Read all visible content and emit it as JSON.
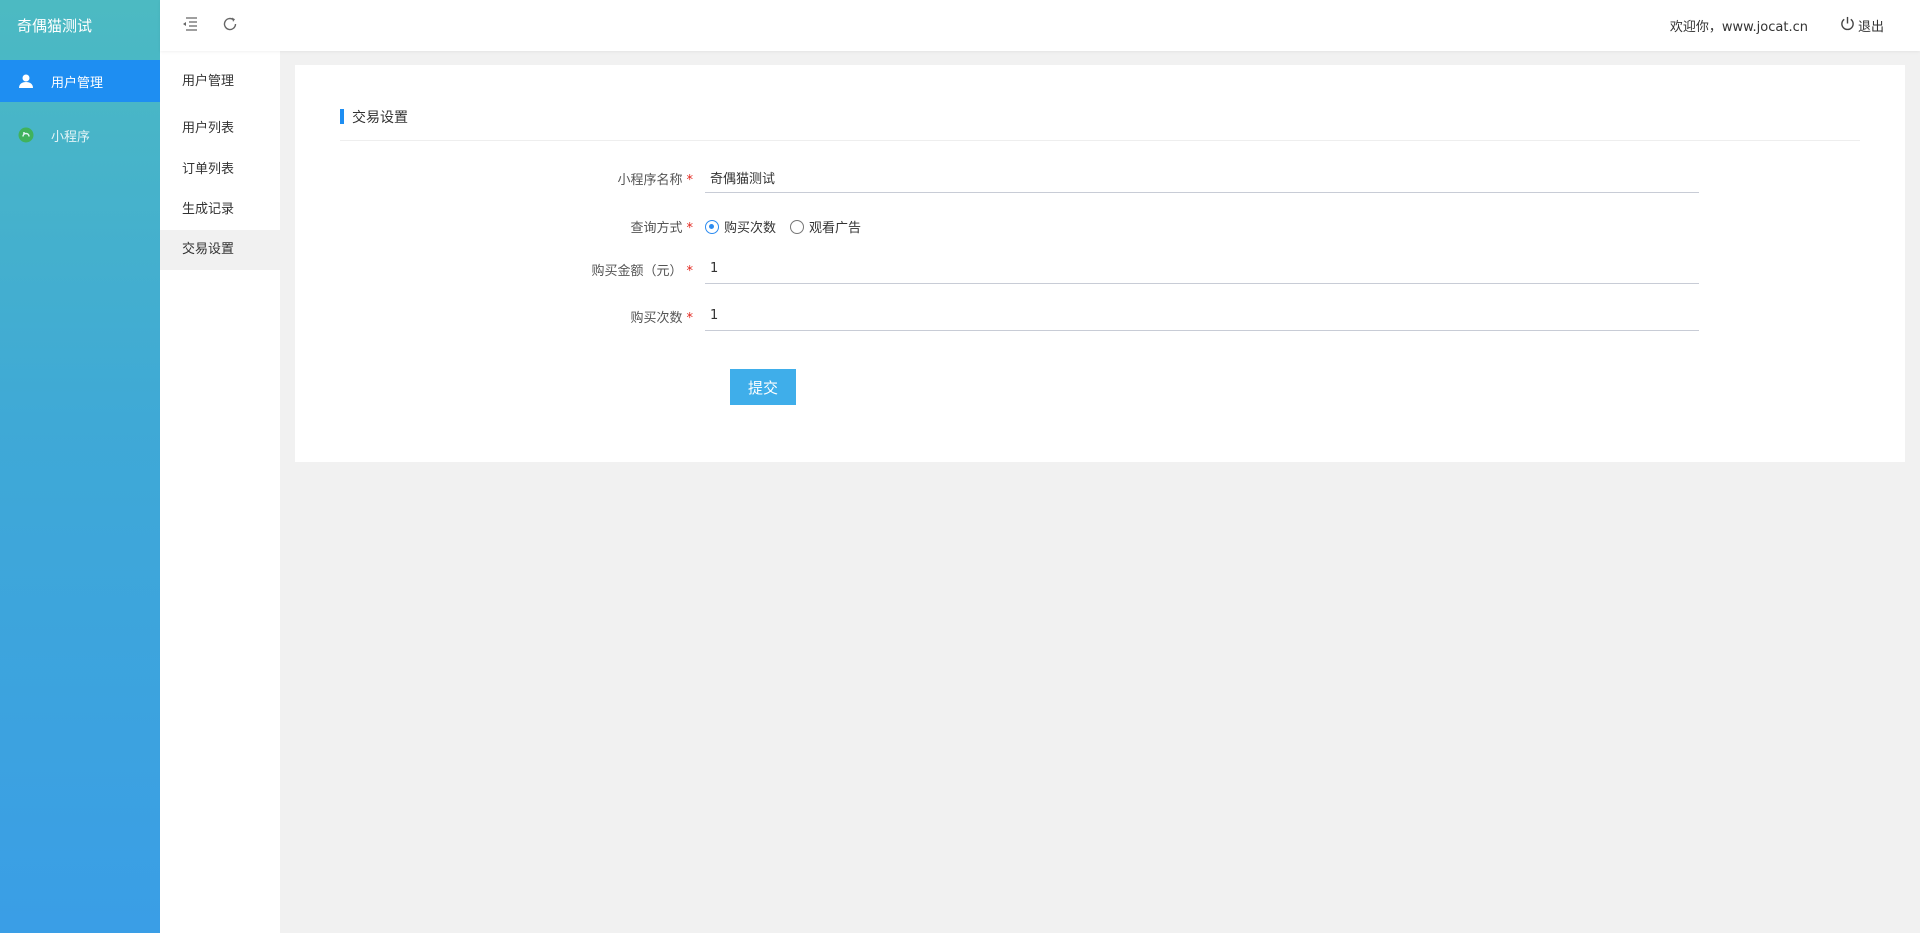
{
  "brand": {
    "title": "奇偶猫测试"
  },
  "sidebar": {
    "items": [
      {
        "label": "用户管理",
        "icon": "user-icon",
        "active": true
      },
      {
        "label": "小程序",
        "icon": "miniprogram-icon",
        "active": false
      }
    ]
  },
  "submenu": {
    "title": "用户管理",
    "items": [
      {
        "label": "用户列表"
      },
      {
        "label": "订单列表"
      },
      {
        "label": "生成记录"
      },
      {
        "label": "交易设置"
      }
    ]
  },
  "header": {
    "welcome": "欢迎你，www.jocat.cn",
    "logout_label": "退出",
    "icons": [
      "menu-fold-icon",
      "refresh-icon",
      "power-icon"
    ]
  },
  "form": {
    "section_title": "交易设置",
    "fields": {
      "app_name": {
        "label": "小程序名称",
        "value": "奇偶猫测试",
        "required": "*"
      },
      "query_mode": {
        "label": "查询方式",
        "required": "*",
        "options": [
          "购买次数",
          "观看广告"
        ],
        "selected": "购买次数"
      },
      "amount": {
        "label": "购买金额（元）",
        "value": "1",
        "required": "*"
      },
      "count": {
        "label": "购买次数",
        "value": "1",
        "required": "*"
      }
    },
    "submit_label": "提交"
  },
  "colors": {
    "accent": "#1e8ef2",
    "button": "#3faeea",
    "required": "#e2231a",
    "sidebar_top": "#4cbac2",
    "sidebar_bottom": "#3a9ee6"
  }
}
